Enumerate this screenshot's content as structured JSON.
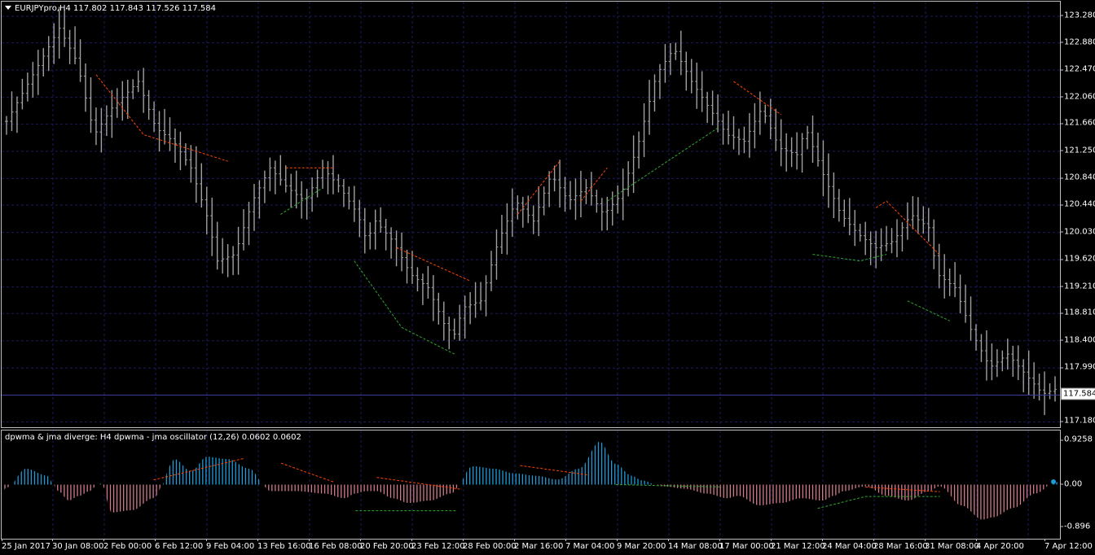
{
  "main": {
    "title": "EURJPYpro,H4  117.802 117.843 117.526 117.584",
    "current_price": "117.584",
    "price_labels": [
      "123.280",
      "122.880",
      "122.470",
      "122.060",
      "121.660",
      "121.250",
      "120.840",
      "120.440",
      "120.030",
      "119.620",
      "119.210",
      "118.810",
      "118.400",
      "117.990",
      "117.180"
    ],
    "ylim": [
      117.1,
      123.5
    ]
  },
  "oscillator": {
    "title": "dpwma & jma diverge: H4   dpwma - jma oscillator (12,26) 0.0602 0.0602",
    "labels": [
      "0.9258",
      "0.00",
      "-0.896"
    ],
    "ylim": [
      -1.0,
      1.0
    ]
  },
  "time_axis": {
    "labels": [
      "25 Jan 2017",
      "30 Jan 08:00",
      "2 Feb 00:00",
      "6 Feb 12:00",
      "9 Feb 04:00",
      "13 Feb 16:00",
      "16 Feb 08:00",
      "20 Feb 20:00",
      "23 Feb 12:00",
      "28 Feb 00:00",
      "2 Mar 16:00",
      "7 Mar 04:00",
      "9 Mar 20:00",
      "14 Mar 08:00",
      "17 Mar 00:00",
      "21 Mar 12:00",
      "24 Mar 04:00",
      "28 Mar 16:00",
      "31 Mar 08:00",
      "4 Apr 20:00",
      "7 Apr 12:00"
    ]
  },
  "colors": {
    "background": "#000000",
    "grid": "#1a1a5c",
    "bars": "#a0a0a0",
    "osc_positive": "#1e9bd7",
    "osc_negative": "#d17b8a",
    "bearish_line": "#ff4500",
    "bullish_line": "#2fa82f"
  },
  "chart_data": [
    {
      "type": "bar",
      "subtype": "ohlc",
      "symbol": "EURJPYpro",
      "timeframe": "H4",
      "last_bar": {
        "open": 117.802,
        "high": 117.843,
        "low": 117.526,
        "close": 117.584
      },
      "close_path": [
        [
          0,
          121.7
        ],
        [
          3,
          122.4
        ],
        [
          6,
          123.1
        ],
        [
          8,
          122.6
        ],
        [
          10,
          121.5
        ],
        [
          12,
          121.9
        ],
        [
          15,
          122.3
        ],
        [
          17,
          121.6
        ],
        [
          19,
          121.4
        ],
        [
          21,
          121.0
        ],
        [
          23,
          120.2
        ],
        [
          24,
          119.6
        ],
        [
          26,
          119.7
        ],
        [
          28,
          120.5
        ],
        [
          30,
          121.0
        ],
        [
          32,
          120.7
        ],
        [
          34,
          120.5
        ],
        [
          36,
          121.0
        ],
        [
          38,
          120.7
        ],
        [
          40,
          120.3
        ],
        [
          41,
          119.9
        ],
        [
          42,
          120.2
        ],
        [
          44,
          119.9
        ],
        [
          46,
          119.4
        ],
        [
          48,
          119.2
        ],
        [
          50,
          118.6
        ],
        [
          51,
          118.5
        ],
        [
          52,
          118.9
        ],
        [
          54,
          119.0
        ],
        [
          56,
          119.9
        ],
        [
          58,
          120.5
        ],
        [
          60,
          120.2
        ],
        [
          62,
          120.9
        ],
        [
          64,
          120.5
        ],
        [
          66,
          120.7
        ],
        [
          68,
          120.3
        ],
        [
          70,
          120.6
        ],
        [
          72,
          121.4
        ],
        [
          74,
          122.4
        ],
        [
          76,
          122.8
        ],
        [
          78,
          122.3
        ],
        [
          80,
          121.9
        ],
        [
          82,
          121.5
        ],
        [
          84,
          121.4
        ],
        [
          86,
          121.9
        ],
        [
          88,
          121.3
        ],
        [
          90,
          121.2
        ],
        [
          91,
          121.6
        ],
        [
          93,
          120.9
        ],
        [
          95,
          120.3
        ],
        [
          97,
          120.0
        ],
        [
          99,
          119.8
        ],
        [
          101,
          119.9
        ],
        [
          103,
          120.3
        ],
        [
          105,
          120.1
        ],
        [
          106,
          119.4
        ],
        [
          108,
          119.2
        ],
        [
          110,
          118.5
        ],
        [
          112,
          118.0
        ],
        [
          114,
          118.2
        ],
        [
          116,
          117.9
        ],
        [
          118,
          117.6
        ],
        [
          120,
          117.7
        ]
      ],
      "divergence_lines": [
        {
          "kind": "bearish",
          "points": [
            [
              17,
              122.4
            ],
            [
              26,
              121.5
            ],
            [
              42,
              121.1
            ]
          ]
        },
        {
          "kind": "bearish",
          "points": [
            [
              53,
              121.0
            ],
            [
              62,
              121.0
            ]
          ]
        },
        {
          "kind": "bullish",
          "points": [
            [
              52,
              120.3
            ],
            [
              60,
              120.7
            ]
          ]
        },
        {
          "kind": "bullish",
          "points": [
            [
              66,
              119.6
            ],
            [
              75,
              118.6
            ],
            [
              85,
              118.2
            ]
          ]
        },
        {
          "kind": "bearish",
          "points": [
            [
              74,
              119.8
            ],
            [
              88,
              119.3
            ]
          ]
        },
        {
          "kind": "bearish",
          "points": [
            [
              97,
              120.3
            ],
            [
              105,
              121.1
            ]
          ]
        },
        {
          "kind": "bearish",
          "points": [
            [
              109,
              120.5
            ],
            [
              114,
              121.0
            ]
          ]
        },
        {
          "kind": "bullish",
          "points": [
            [
              114,
              120.5
            ],
            [
              135,
              121.6
            ]
          ]
        },
        {
          "kind": "bearish",
          "points": [
            [
              138,
              122.3
            ],
            [
              147,
              121.8
            ]
          ]
        },
        {
          "kind": "bearish",
          "points": [
            [
              165,
              120.4
            ],
            [
              167,
              120.5
            ],
            [
              177,
              119.7
            ]
          ]
        },
        {
          "kind": "bullish",
          "points": [
            [
              153,
              119.7
            ],
            [
              162,
              119.6
            ],
            [
              167,
              119.7
            ]
          ]
        },
        {
          "kind": "bullish",
          "points": [
            [
              171,
              119.0
            ],
            [
              179,
              118.7
            ]
          ]
        }
      ]
    },
    {
      "type": "bar",
      "subtype": "histogram",
      "name": "dpwma - jma oscillator (12,26)",
      "value": 0.0602,
      "x": [
        0,
        4,
        8,
        10,
        12,
        14,
        16,
        18,
        20,
        24,
        28,
        32,
        35,
        38,
        42,
        46,
        50,
        55,
        60,
        64,
        66,
        68,
        70,
        73,
        76,
        80,
        84,
        88,
        92,
        96,
        100,
        104,
        108,
        112,
        115,
        118,
        120,
        124,
        128,
        132,
        136,
        138,
        142,
        146,
        150,
        154,
        156,
        158,
        162,
        166,
        170,
        174,
        176,
        180,
        184,
        186,
        190,
        194,
        198
      ],
      "values": [
        -0.1,
        0.35,
        0.2,
        -0.15,
        -0.35,
        -0.25,
        -0.15,
        0.05,
        -0.6,
        -0.55,
        -0.3,
        0.55,
        0.3,
        0.6,
        0.55,
        0.35,
        -0.15,
        -0.15,
        -0.2,
        -0.3,
        -0.2,
        -0.15,
        -0.15,
        -0.3,
        -0.4,
        -0.35,
        -0.2,
        0.4,
        0.35,
        0.25,
        0.2,
        0.12,
        0.35,
        0.92,
        0.45,
        0.2,
        0.1,
        -0.05,
        -0.1,
        -0.2,
        -0.3,
        -0.25,
        -0.45,
        -0.4,
        -0.3,
        -0.35,
        -0.25,
        -0.15,
        -0.05,
        -0.25,
        -0.35,
        -0.15,
        -0.05,
        -0.45,
        -0.75,
        -0.7,
        -0.5,
        -0.2,
        0.06
      ],
      "ylim": [
        -0.896,
        0.9258
      ],
      "divergence_lines": [
        {
          "kind": "bearish",
          "points": [
            [
              28,
              0.1
            ],
            [
              45,
              0.55
            ]
          ]
        },
        {
          "kind": "bearish",
          "points": [
            [
              52,
              0.45
            ],
            [
              62,
              0.05
            ]
          ]
        },
        {
          "kind": "bullish",
          "points": [
            [
              66,
              -0.55
            ],
            [
              85,
              -0.55
            ]
          ]
        },
        {
          "kind": "bearish",
          "points": [
            [
              70,
              0.15
            ],
            [
              86,
              -0.1
            ]
          ]
        },
        {
          "kind": "bullish",
          "points": [
            [
              115,
              0.0
            ],
            [
              135,
              -0.05
            ]
          ]
        },
        {
          "kind": "bearish",
          "points": [
            [
              97,
              0.4
            ],
            [
              110,
              0.2
            ]
          ]
        },
        {
          "kind": "bullish",
          "points": [
            [
              153,
              -0.5
            ],
            [
              162,
              -0.25
            ],
            [
              176,
              -0.25
            ]
          ]
        },
        {
          "kind": "bearish",
          "points": [
            [
              162,
              -0.05
            ],
            [
              176,
              -0.15
            ]
          ]
        }
      ]
    }
  ]
}
